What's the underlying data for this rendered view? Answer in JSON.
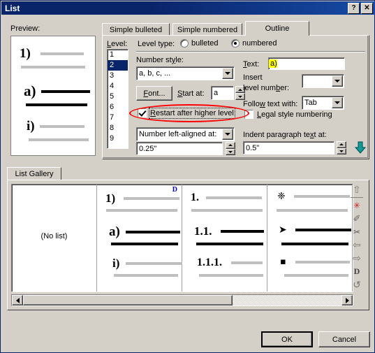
{
  "window": {
    "title": "List",
    "help_button": "?",
    "close_button": "✕"
  },
  "preview": {
    "label": "Preview:",
    "rows": [
      {
        "marker": "1)",
        "style": "light"
      },
      {
        "marker": "",
        "style": "light"
      },
      {
        "marker": "a)",
        "style": "bold"
      },
      {
        "marker": "",
        "style": "bold"
      },
      {
        "marker": "i)",
        "style": "light"
      },
      {
        "marker": "",
        "style": "light"
      }
    ]
  },
  "tabs": {
    "items": [
      {
        "label": "Simple bulleted",
        "active": false
      },
      {
        "label": "Simple numbered",
        "active": false
      },
      {
        "label": "Outline",
        "active": true
      }
    ]
  },
  "outline": {
    "level_label": "Level:",
    "levels": [
      "1",
      "2",
      "3",
      "4",
      "5",
      "6",
      "7",
      "8",
      "9"
    ],
    "selected_level": "2",
    "level_type_label": "Level type:",
    "level_type_bulleted": "bulleted",
    "level_type_numbered": "numbered",
    "level_type_selected": "numbered",
    "number_style_label": "Number style:",
    "number_style_value": "a, b, c, ...",
    "font_button": "Font...",
    "start_at_label": "Start at:",
    "start_at_value": "a",
    "restart_checkbox_label": "Restart after higher level",
    "restart_checked": true,
    "number_align_value": "Number left-aligned at:",
    "number_align_at_value": "0.25\"",
    "text_label": "Text:",
    "text_value": "a)",
    "insert_level_number_label_l1": "Insert",
    "insert_level_number_label_l2": "level number:",
    "insert_level_number_value": "",
    "follow_text_label": "Follow text with:",
    "follow_text_value": "Tab",
    "legal_style_label": "Legal style numbering",
    "legal_style_checked": false,
    "indent_paragraph_label": "Indent paragraph text at:",
    "indent_paragraph_value": "0.5\"",
    "more_arrow_icon": "down-arrow-icon"
  },
  "gallery": {
    "tab_label": "List Gallery",
    "cells": [
      {
        "type": "nolist",
        "caption": "(No list)",
        "marked": false,
        "marker_badge": "",
        "rows": []
      },
      {
        "type": "list",
        "caption": "",
        "marked": true,
        "marker_badge": "D",
        "rows": [
          {
            "marker": "1)",
            "style": "light"
          },
          {
            "marker": "",
            "style": "light"
          },
          {
            "marker": "a)",
            "style": "bold"
          },
          {
            "marker": "",
            "style": "bold"
          },
          {
            "marker": "i)",
            "style": "light"
          },
          {
            "marker": "",
            "style": "light"
          }
        ]
      },
      {
        "type": "list",
        "caption": "",
        "marked": false,
        "marker_badge": "",
        "rows": [
          {
            "marker": "1.",
            "style": "light"
          },
          {
            "marker": "",
            "style": "light"
          },
          {
            "marker": "1.1.",
            "style": "bold"
          },
          {
            "marker": "",
            "style": "bold"
          },
          {
            "marker": "1.1.1.",
            "style": "light"
          },
          {
            "marker": "",
            "style": "light"
          }
        ]
      },
      {
        "type": "list",
        "caption": "",
        "marked": false,
        "marker_badge": "",
        "rows": [
          {
            "marker": "❈",
            "style": "light"
          },
          {
            "marker": "",
            "style": "light"
          },
          {
            "marker": "➤",
            "style": "bold"
          },
          {
            "marker": "",
            "style": "bold"
          },
          {
            "marker": "▪",
            "style": "light"
          },
          {
            "marker": "",
            "style": "light"
          }
        ]
      }
    ],
    "scroll_left_icon": "triangle-left-icon",
    "scroll_right_icon": "triangle-right-icon",
    "tools": [
      {
        "icon": "move-up-icon",
        "glyph": "⇧"
      },
      {
        "icon": "separator",
        "glyph": ""
      },
      {
        "icon": "new-style-icon",
        "glyph": "✳"
      },
      {
        "icon": "modify-style-icon",
        "glyph": "✐"
      },
      {
        "icon": "delete-style-icon",
        "glyph": "✂"
      },
      {
        "icon": "promote-icon",
        "glyph": "⇦"
      },
      {
        "icon": "demote-icon",
        "glyph": "⇨"
      },
      {
        "icon": "default-style-icon",
        "glyph": "D"
      },
      {
        "icon": "reset-icon",
        "glyph": "↺"
      }
    ]
  },
  "footer": {
    "ok_label": "OK",
    "cancel_label": "Cancel"
  },
  "colors": {
    "titlebar": "#0a246a",
    "dialog_face": "#d4d0c8",
    "selection": "#0a246a",
    "annotation": "#ff0000",
    "highlight_field": "#ffff00",
    "badge": "#0000cc",
    "arrow": "#008080"
  }
}
